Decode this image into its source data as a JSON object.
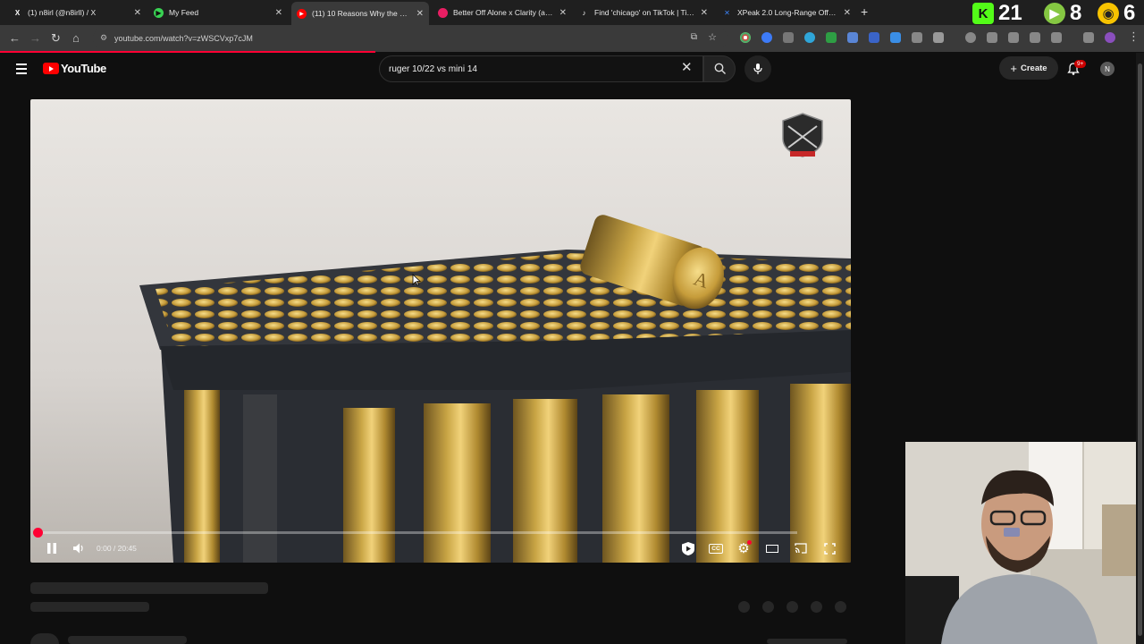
{
  "browser": {
    "tabs": [
      {
        "title": "(1) n8irl (@n8irll) / X",
        "icon": "x-logo-icon",
        "icon_color": "#ffffff",
        "active": false
      },
      {
        "title": "My Feed",
        "icon": "play-feed-icon",
        "icon_color": "#39d353",
        "active": false
      },
      {
        "title": "(11) 10 Reasons Why the Ruger",
        "icon": "youtube-icon",
        "icon_color": "#ff0000",
        "active": true
      },
      {
        "title": "Better Off Alone x Clarity (agai",
        "icon": "record-icon",
        "icon_color": "#e91e63",
        "active": false
      },
      {
        "title": "Find 'chicago' on TikTok | TikTo",
        "icon": "tiktok-icon",
        "icon_color": "#ffffff",
        "active": false
      },
      {
        "title": "XPeak 2.0 Long-Range Off-Roa",
        "icon": "x-logo-icon",
        "icon_color": "#3b82f6",
        "active": false
      }
    ],
    "counters": [
      {
        "icon": "kick-icon",
        "label": "K",
        "value": "21",
        "color": "#53fc18"
      },
      {
        "icon": "rumble-play-icon",
        "label": "▶",
        "value": "8",
        "color": "#85c742"
      },
      {
        "icon": "mask-icon",
        "label": "◉",
        "value": "6",
        "color": "#f7c300"
      }
    ],
    "url": "youtube.com/watch?v=zWSCVxp7cJM"
  },
  "youtube": {
    "logo_text": "YouTube",
    "search_value": "ruger 10/22 vs mini 14",
    "create_label": "Create",
    "notification_badge": "9+",
    "avatar_letter": "N",
    "brand_color": "#ff0000"
  },
  "player": {
    "time_display": "0:00 / 20:45",
    "progress": 0.0,
    "state": "playing"
  }
}
